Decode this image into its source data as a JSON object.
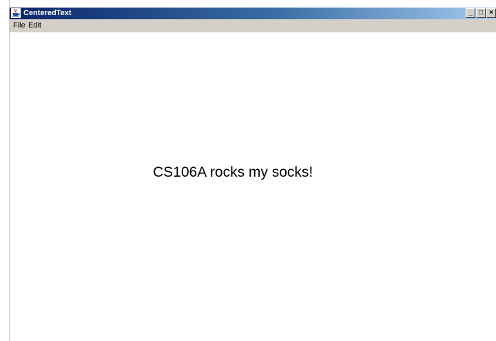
{
  "window": {
    "title": "CenteredText",
    "buttons": {
      "minimize": "_",
      "maximize": "□",
      "close": "×"
    }
  },
  "menu": {
    "items": [
      "File",
      "Edit"
    ]
  },
  "canvas": {
    "message": "CS106A rocks my socks!"
  },
  "icons": {
    "app_icon": "java-coffee-cup-icon"
  },
  "colors": {
    "titlebar_start": "#0a246a",
    "titlebar_end": "#a6caf0",
    "menubar_bg": "#d4d0c8",
    "canvas_bg": "#ffffff"
  }
}
